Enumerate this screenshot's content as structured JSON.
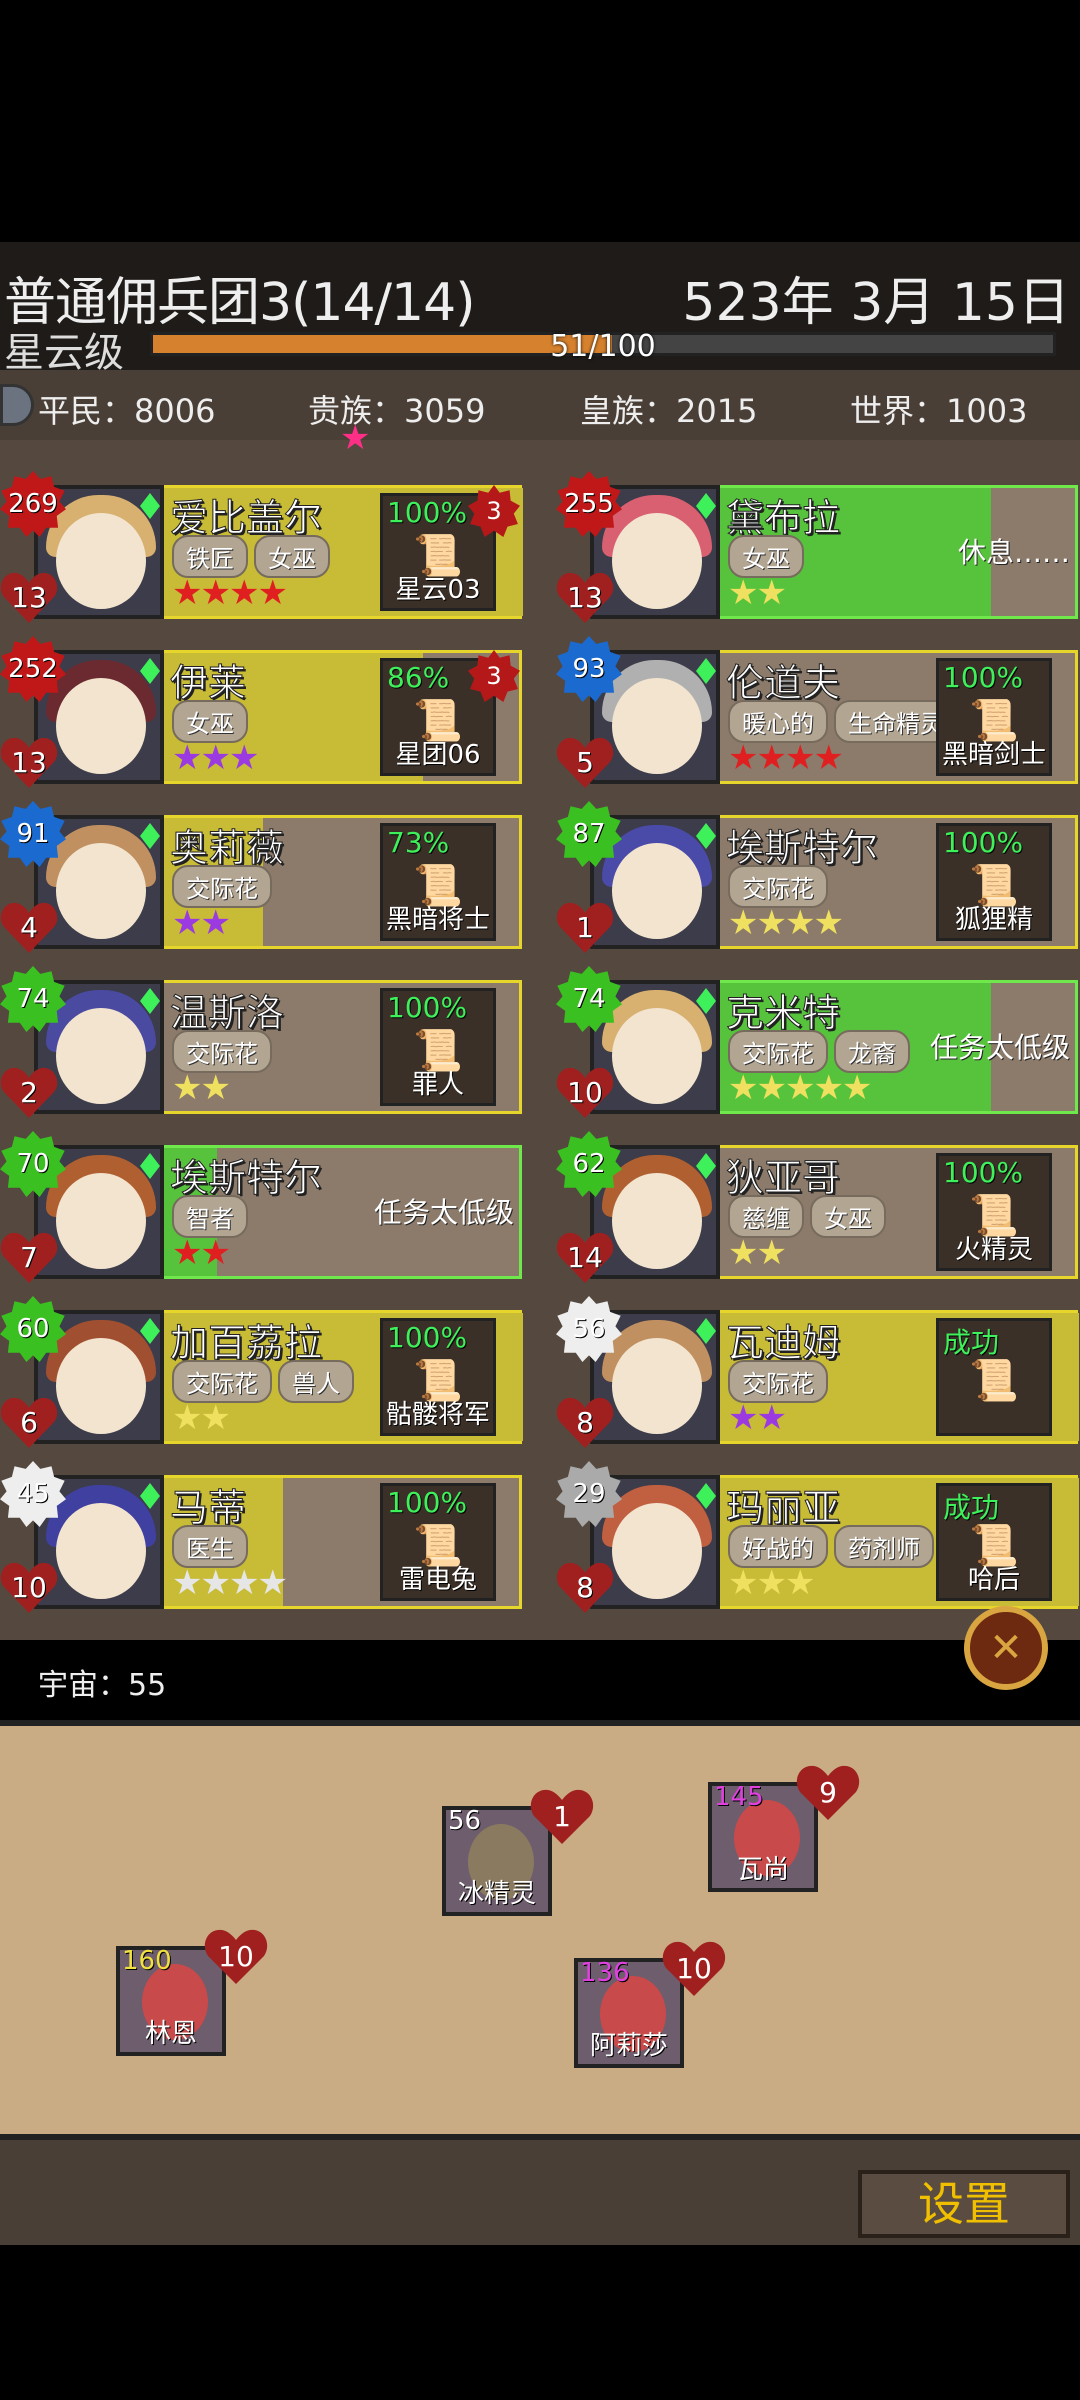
{
  "header": {
    "team": "普通佣兵团3(14/14)",
    "date": "523年 3月 15日",
    "rank": "星云级",
    "xp_text": "51/100",
    "xp_fraction": 0.51
  },
  "stats": {
    "commoner": "平民：8006",
    "noble": "贵族：3059",
    "royal": "皇族：2015",
    "world": "世界：1003"
  },
  "mercs": [
    {
      "name": "爱比盖尔",
      "tags": [
        "铁匠",
        "女巫"
      ],
      "level": "269",
      "hearts": "13",
      "stars": "★★★★",
      "star_color": "#e02020",
      "task_pct": "100%",
      "task_name": "星云03",
      "task_badge": "3",
      "status": ""
    },
    {
      "name": "伊莱",
      "tags": [
        "女巫"
      ],
      "level": "252",
      "hearts": "13",
      "stars": "★★★",
      "star_color": "#9a3ae0",
      "task_pct": "86%",
      "task_name": "星团06",
      "task_badge": "3",
      "status": ""
    },
    {
      "name": "奥莉薇",
      "tags": [
        "交际花"
      ],
      "level": "91",
      "hearts": "4",
      "stars": "★★",
      "star_color": "#9a3ae0",
      "task_pct": "73%",
      "task_name": "黑暗将士",
      "task_badge": "",
      "status": ""
    },
    {
      "name": "温斯洛",
      "tags": [
        "交际花"
      ],
      "level": "74",
      "hearts": "2",
      "stars": "★★",
      "star_color": "#f0e060",
      "task_pct": "100%",
      "task_name": "罪人",
      "task_badge": "",
      "status": ""
    },
    {
      "name": "埃斯特尔",
      "tags": [
        "智者"
      ],
      "level": "70",
      "hearts": "7",
      "stars": "★★",
      "star_color": "#e02020",
      "task_pct": "",
      "task_name": "",
      "task_badge": "",
      "status": "任务太低级"
    },
    {
      "name": "加百荔拉",
      "tags": [
        "交际花",
        "兽人"
      ],
      "level": "60",
      "hearts": "6",
      "stars": "★★",
      "star_color": "#f0e060",
      "task_pct": "100%",
      "task_name": "骷髅将军",
      "task_badge": "",
      "status": ""
    },
    {
      "name": "马蒂",
      "tags": [
        "医生"
      ],
      "level": "45",
      "hearts": "10",
      "stars": "★★★★",
      "star_color": "#e6e6e6",
      "task_pct": "100%",
      "task_name": "雷电兔",
      "task_badge": "",
      "status": ""
    },
    {
      "name": "黛布拉",
      "tags": [
        "女巫"
      ],
      "level": "255",
      "hearts": "13",
      "stars": "★★",
      "star_color": "#f0e060",
      "task_pct": "",
      "task_name": "",
      "task_badge": "",
      "status": "休息……"
    },
    {
      "name": "伦道夫",
      "tags": [
        "暖心的",
        "生命精灵"
      ],
      "level": "93",
      "hearts": "5",
      "stars": "★★★★",
      "star_color": "#e02020",
      "task_pct": "100%",
      "task_name": "黑暗剑士",
      "task_badge": "",
      "status": ""
    },
    {
      "name": "埃斯特尔",
      "tags": [
        "交际花"
      ],
      "level": "87",
      "hearts": "1",
      "stars": "★★★★",
      "star_color": "#f0e060",
      "task_pct": "100%",
      "task_name": "狐狸精",
      "task_badge": "",
      "status": ""
    },
    {
      "name": "克米特",
      "tags": [
        "交际花",
        "龙裔"
      ],
      "level": "74",
      "hearts": "10",
      "stars": "★★★★★",
      "star_color": "#f0e060",
      "task_pct": "",
      "task_name": "",
      "task_badge": "",
      "status": "任务太低级"
    },
    {
      "name": "狄亚哥",
      "tags": [
        "慈缠",
        "女巫"
      ],
      "level": "62",
      "hearts": "14",
      "stars": "★★",
      "star_color": "#f0e060",
      "task_pct": "100%",
      "task_name": "火精灵",
      "task_badge": "",
      "status": ""
    },
    {
      "name": "瓦迪姆",
      "tags": [
        "交际花"
      ],
      "level": "56",
      "hearts": "8",
      "stars": "★★",
      "star_color": "#9a3ae0",
      "task_pct": "成功",
      "task_name": "",
      "task_badge": "",
      "status": ""
    },
    {
      "name": "玛丽亚",
      "tags": [
        "好战的",
        "药剂师"
      ],
      "level": "29",
      "hearts": "8",
      "stars": "★★★",
      "star_color": "#f0e060",
      "task_pct": "成功",
      "task_name": "哈后",
      "task_badge": "",
      "status": ""
    }
  ],
  "universe": "宇宙：55",
  "floor_units": [
    {
      "level": "56",
      "hearts": "1",
      "name": "冰精灵",
      "level_color": "#ffffff"
    },
    {
      "level": "145",
      "hearts": "9",
      "name": "瓦尚",
      "level_color": "#e040e0"
    },
    {
      "level": "160",
      "hearts": "10",
      "name": "林恩",
      "level_color": "#f0e040"
    },
    {
      "level": "136",
      "hearts": "10",
      "name": "阿莉莎",
      "level_color": "#e040e0"
    }
  ],
  "settings_label": "设置",
  "close_label": "✕",
  "colors": {
    "xp": "#d6812d",
    "card_yellow": "#c8bb36",
    "card_green": "#57c33d"
  }
}
